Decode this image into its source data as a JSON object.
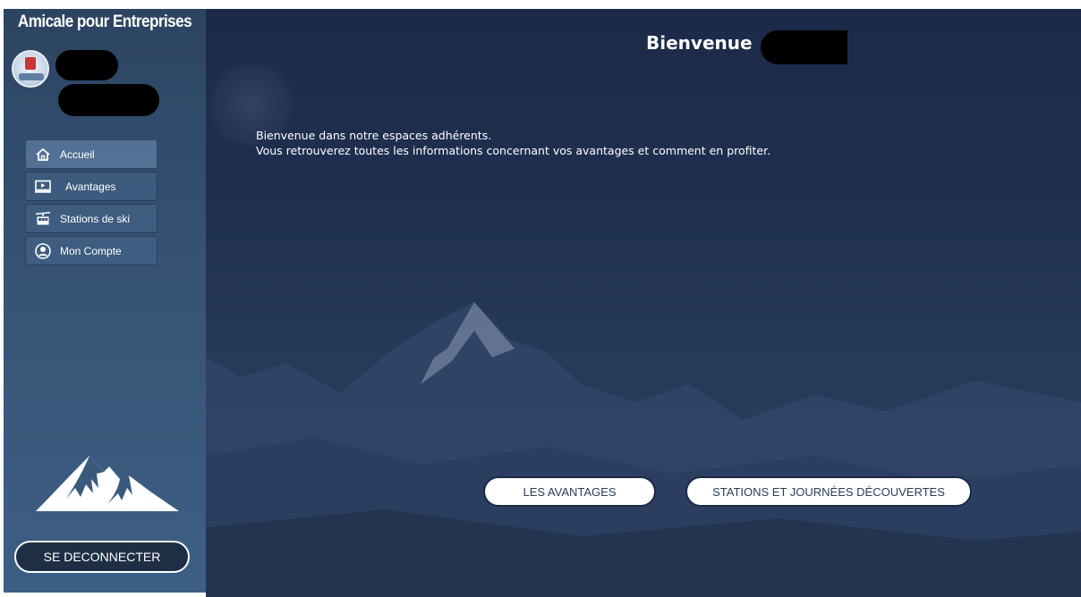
{
  "sidebar": {
    "brand": "Amicale pour Entreprises",
    "nav": [
      {
        "label": "Accueil",
        "icon": "home-icon",
        "active": true
      },
      {
        "label": "Avantages",
        "icon": "presentation-icon",
        "active": false
      },
      {
        "label": "Stations de ski",
        "icon": "cable-car-icon",
        "active": false
      },
      {
        "label": "Mon Compte",
        "icon": "user-circle-icon",
        "active": false
      }
    ],
    "logout_label": "SE DECONNECTER"
  },
  "main": {
    "title": "Bienvenue",
    "intro_line1": "Bienvenue dans notre espaces adhérents.",
    "intro_line2": "Vous retrouverez toutes les informations concernant vos avantages et comment en profiter.",
    "buttons": {
      "avantages": "LES AVANTAGES",
      "stations": "STATIONS ET JOURNÉES DÉCOUVERTES"
    }
  },
  "colors": {
    "sidebar_bg": "#355273",
    "main_bg": "#1f3050",
    "text": "#ffffff",
    "pill_text": "#2a3d59"
  }
}
